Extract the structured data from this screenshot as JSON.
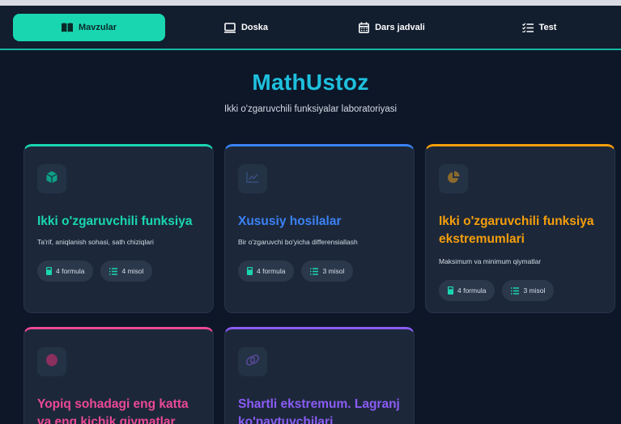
{
  "nav": {
    "tabs": [
      {
        "label": "Mavzular",
        "icon": "book-icon"
      },
      {
        "label": "Doska",
        "icon": "whiteboard-icon"
      },
      {
        "label": "Dars jadvali",
        "icon": "calendar-icon"
      },
      {
        "label": "Test",
        "icon": "list-check-icon"
      }
    ]
  },
  "hero": {
    "title": "MathUstoz",
    "subtitle": "Ikki o'zgaruvchili funksiyalar laboratoriyasi"
  },
  "cards": [
    {
      "title": "Ikki o'zgaruvchili funksiya",
      "description": "Ta'rif, aniqlanish sohasi, sath chiziqlari",
      "formula": "4 formula",
      "misol": "4 misol",
      "accent": "#19d6b1",
      "icon": "cube-icon"
    },
    {
      "title": "Xususiy hosilalar",
      "description": "Bir o'zgaruvchi bo'yicha differensiallash",
      "formula": "4 formula",
      "misol": "3 misol",
      "accent": "#3b82f6",
      "icon": "chart-line-icon"
    },
    {
      "title": "Ikki o'zgaruvchili funksiya ekstremumlari",
      "description": "Maksimum va minimum qiymatlar",
      "formula": "4 formula",
      "misol": "3 misol",
      "accent": "#f59e0b",
      "icon": "pie-chart-icon"
    },
    {
      "title": "Yopiq sohadagi eng katta va eng kichik qiymatlar",
      "accent": "#ec4899",
      "icon": "circle-icon"
    },
    {
      "title": "Shartli ekstremum. Lagranj ko'paytuvchilari",
      "accent": "#8b5cf6",
      "icon": "link-icon"
    }
  ]
}
